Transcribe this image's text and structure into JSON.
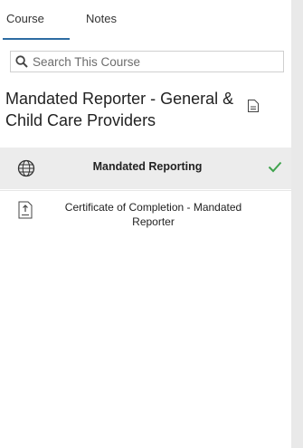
{
  "tabs": [
    {
      "label": "Course",
      "active": true
    },
    {
      "label": "Notes",
      "active": false
    }
  ],
  "search": {
    "placeholder": "Search This Course",
    "value": ""
  },
  "course": {
    "title": "Mandated Reporter - General & Child Care Providers"
  },
  "items": [
    {
      "label": "Mandated Reporting",
      "icon": "globe-icon",
      "status": "completed",
      "selected": true
    },
    {
      "label": "Certificate of Completion - Mandated Reporter",
      "icon": "file-download-icon",
      "selected": false
    }
  ],
  "colors": {
    "accent": "#2d6ca2",
    "check": "#3fa34d",
    "selected_bg": "#ececec",
    "scrollbar": "#e9e9e9"
  }
}
